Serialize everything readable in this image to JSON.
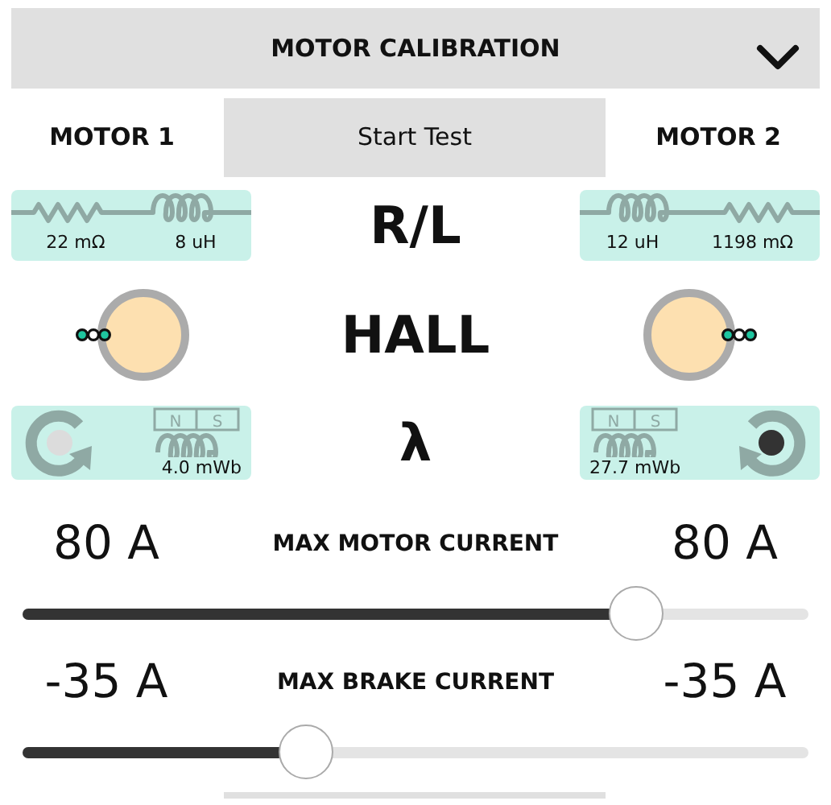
{
  "header": {
    "title": "MOTOR CALIBRATION"
  },
  "start_button": "Start Test",
  "motors": [
    {
      "label": "MOTOR 1",
      "resistance": "22 mΩ",
      "inductance": "8 uH",
      "magnet": [
        "N",
        "S"
      ],
      "flux_linkage": "4.0 mWb",
      "color": "#dcdcdc"
    },
    {
      "label": "MOTOR 2",
      "resistance": "1198 mΩ",
      "inductance": "12 uH",
      "magnet": [
        "N",
        "S"
      ],
      "flux_linkage": "27.7 mWb",
      "color": "#333333"
    }
  ],
  "rows": [
    "R/L",
    "HALL",
    "λ"
  ],
  "sliders": [
    {
      "label": "MAX MOTOR CURRENT",
      "left_value": "80 A",
      "right_value": "80 A",
      "level": 0.78
    },
    {
      "label": "MAX BRAKE CURRENT",
      "left_value": "-35 A",
      "right_value": "-35 A",
      "level": 0.36
    }
  ]
}
